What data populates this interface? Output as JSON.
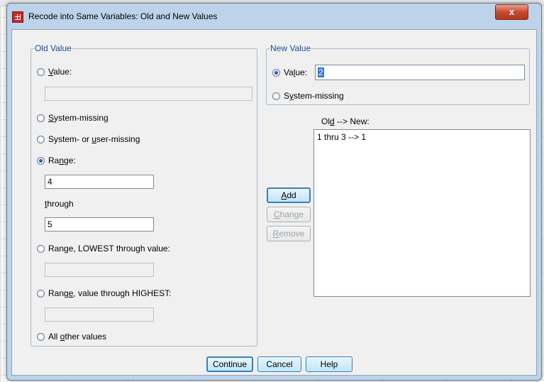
{
  "window": {
    "title": "Recode into Same Variables: Old and New Values",
    "close_glyph": "x"
  },
  "old_value": {
    "legend": "Old Value",
    "value_radio": {
      "pre": "",
      "acc": "V",
      "post": "alue:"
    },
    "value_input": "",
    "system_missing": {
      "pre": "",
      "acc": "S",
      "post": "ystem-missing"
    },
    "system_or_user_missing": {
      "pre": "System- or ",
      "acc": "u",
      "post": "ser-missing"
    },
    "range": {
      "pre": "Ra",
      "acc": "n",
      "post": "ge:"
    },
    "range_from": "4",
    "through_label": {
      "pre": "",
      "acc": "t",
      "post": "hrough"
    },
    "range_to": "5",
    "range_lowest": {
      "pre": "Ran",
      "acc": "g",
      "post": "e, LOWEST through value:"
    },
    "range_lowest_input": "",
    "range_highest": {
      "pre": "Rang",
      "acc": "e",
      "post": ", value through HIGHEST:"
    },
    "range_highest_input": "",
    "all_other": {
      "pre": "All ",
      "acc": "o",
      "post": "ther values"
    }
  },
  "new_value": {
    "legend": "New Value",
    "value_radio": {
      "pre": "Va",
      "acc": "l",
      "post": "ue:"
    },
    "value_input": "2",
    "system_missing": {
      "pre": "S",
      "acc": "y",
      "post": "stem-missing"
    }
  },
  "mapping": {
    "label": {
      "pre": "Ol",
      "acc": "d",
      "post": " --> New:"
    },
    "items": [
      "1 thru 3 --> 1"
    ]
  },
  "side_buttons": {
    "add": {
      "pre": "",
      "acc": "A",
      "post": "dd"
    },
    "change": {
      "pre": "",
      "acc": "C",
      "post": "hange"
    },
    "remove": {
      "pre": "",
      "acc": "R",
      "post": "emove"
    }
  },
  "footer": {
    "continue": "Continue",
    "cancel": "Cancel",
    "help": "Help"
  },
  "selected": {
    "old_value": "range",
    "new_value": "value"
  },
  "colors": {
    "legend": "#1a4f9c",
    "accent": "#3c7fb1",
    "close": "#c74a2f"
  }
}
